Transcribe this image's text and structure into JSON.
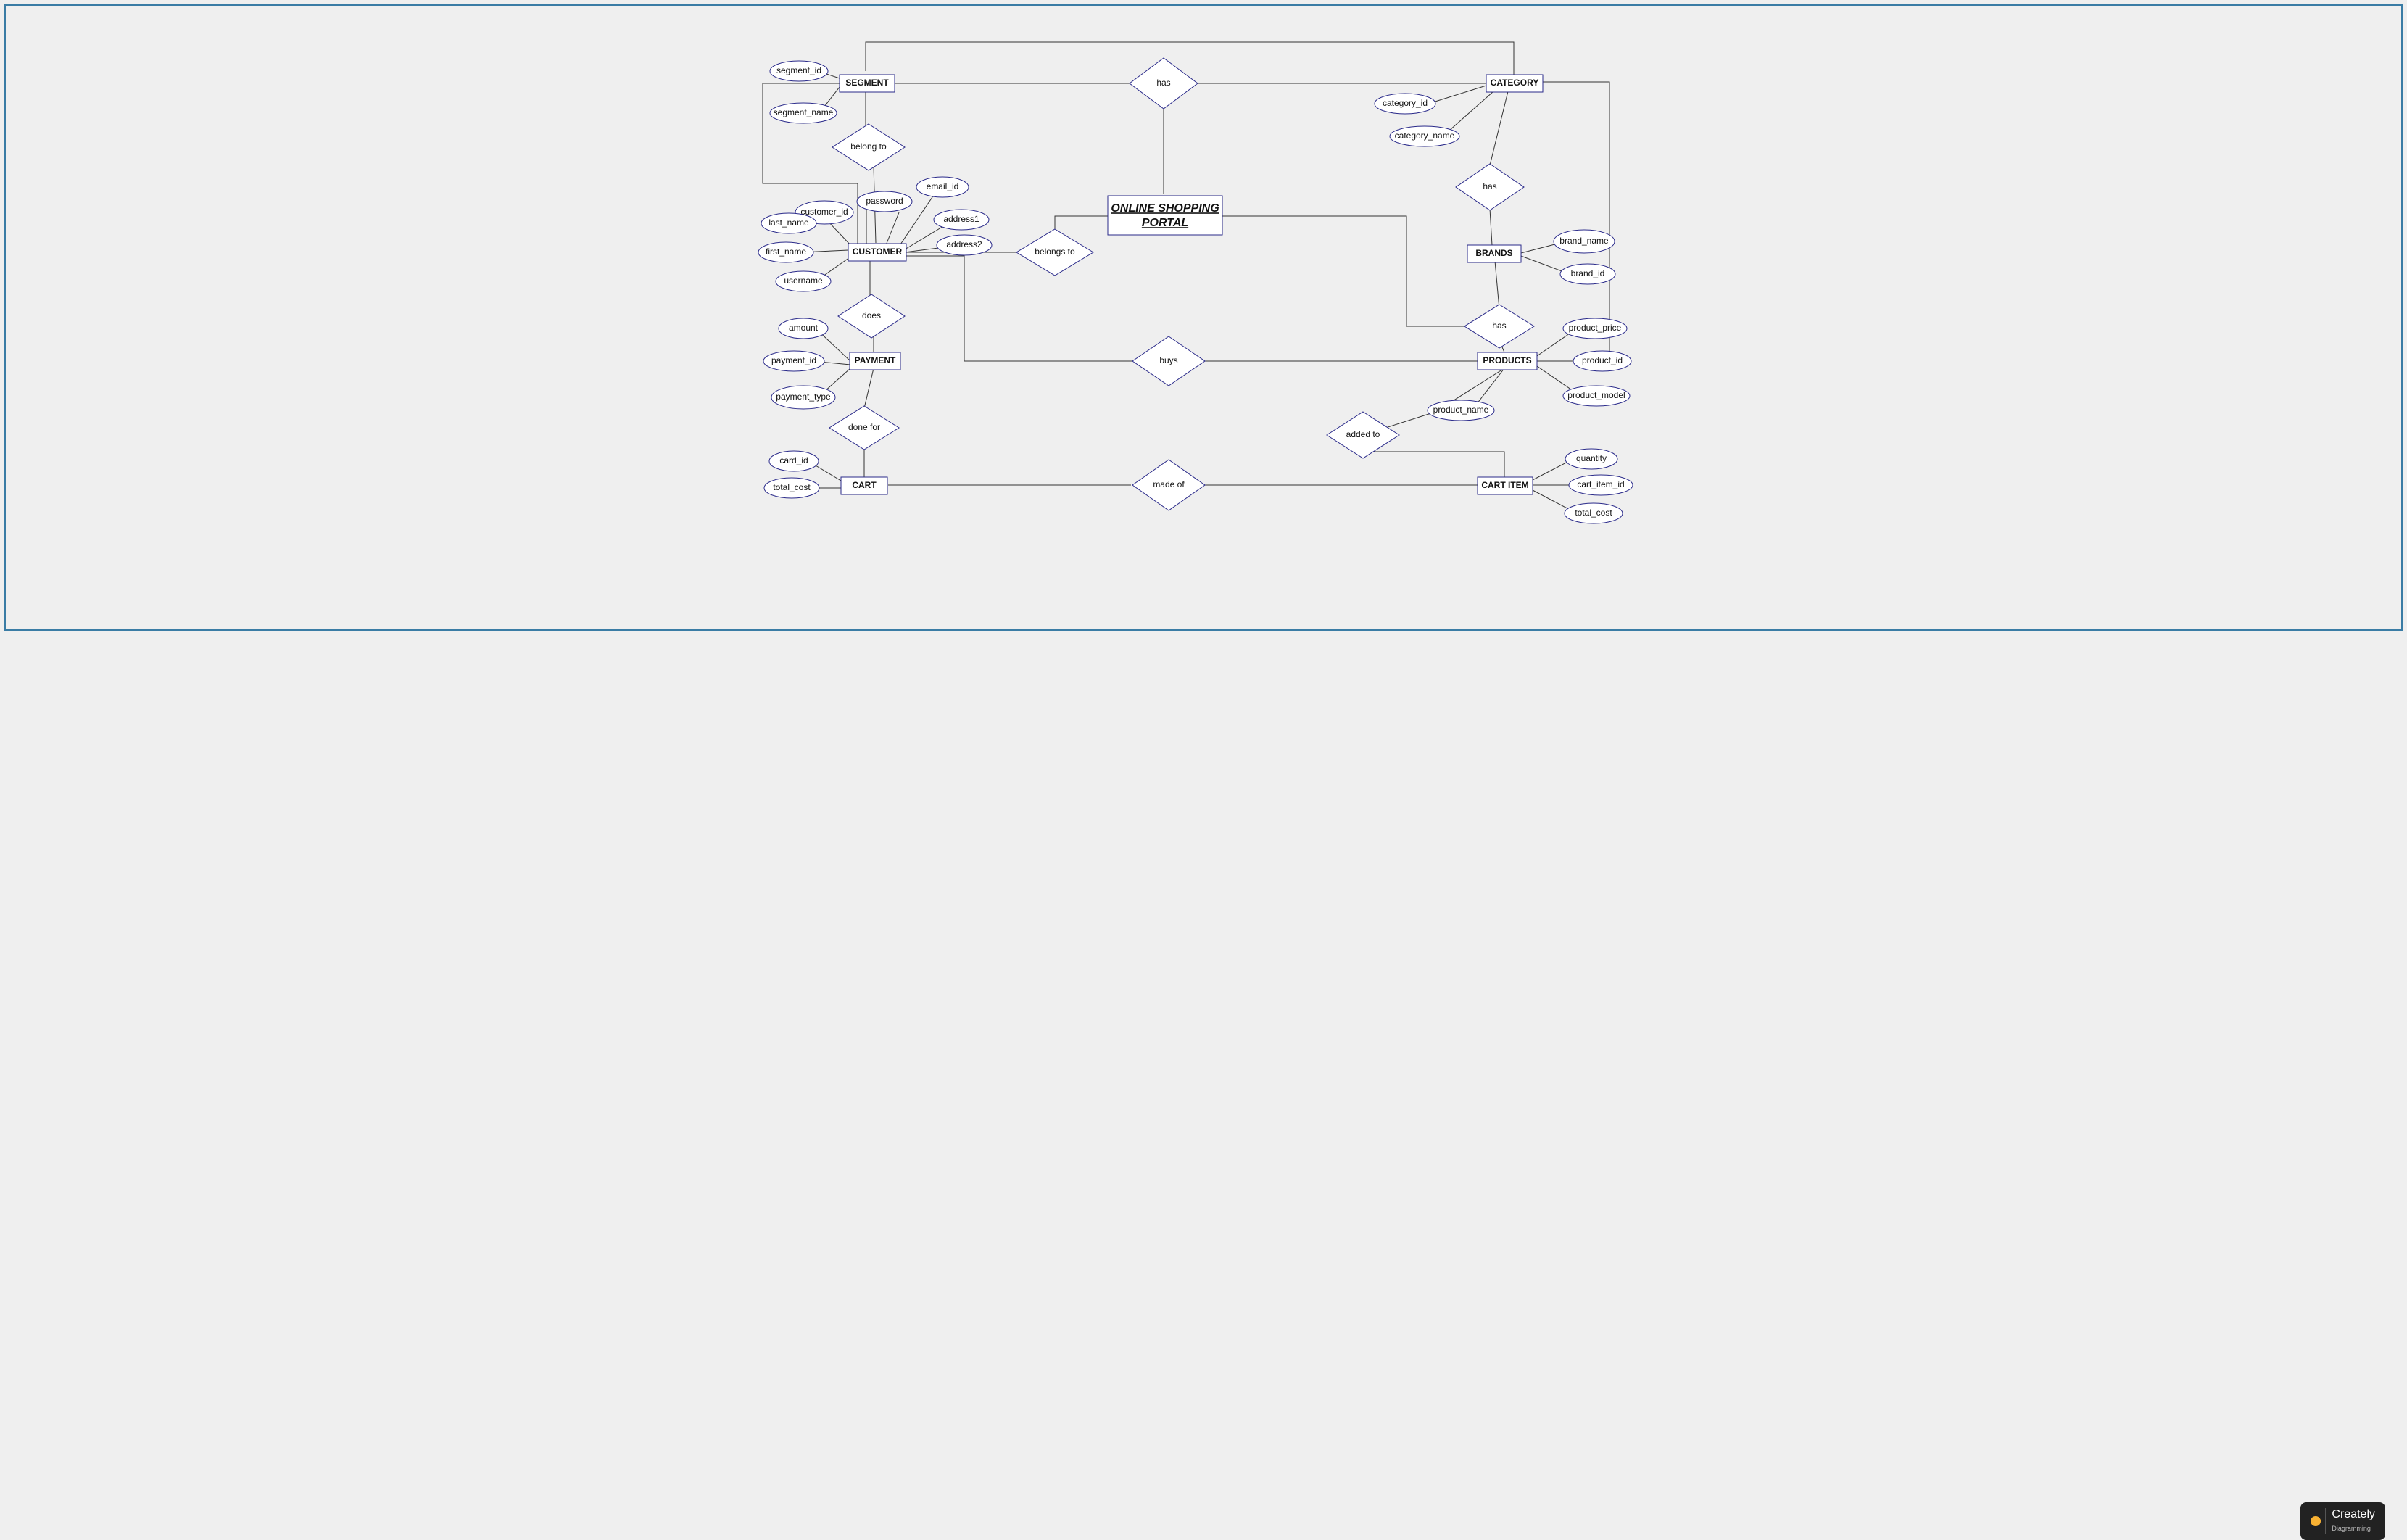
{
  "title": {
    "line1": "ONLINE SHOPPING",
    "line2": "PORTAL"
  },
  "entities": {
    "segment": "SEGMENT",
    "category": "CATEGORY",
    "brands": "BRANDS",
    "customer": "CUSTOMER",
    "payment": "PAYMENT",
    "cart": "CART",
    "products": "PRODUCTS",
    "cartitem": "CART ITEM"
  },
  "relations": {
    "has_top": "has",
    "has_cb": "has",
    "has_bp": "has",
    "belong_to": "belong to",
    "belongs_to": "belongs to",
    "does": "does",
    "buys": "buys",
    "done_for": "done for",
    "made_of": "made of",
    "added_to": "added to"
  },
  "attrs": {
    "segment_id": "segment_id",
    "segment_name": "segment_name",
    "category_id": "category_id",
    "category_name": "category_name",
    "brand_name": "brand_name",
    "brand_id": "brand_id",
    "customer_id": "customer_id",
    "password": "password",
    "email_id": "email_id",
    "last_name": "last_name",
    "first_name": "first_name",
    "username": "username",
    "address1": "address1",
    "address2": "address2",
    "amount": "amount",
    "payment_id": "payment_id",
    "payment_type": "payment_type",
    "card_id": "card_id",
    "total_cost": "total_cost",
    "product_price": "product_price",
    "product_id": "product_id",
    "product_model": "product_model",
    "product_name": "product_name",
    "quantity": "quantity",
    "cart_item_id": "cart_item_id",
    "total_cost2": "total_cost"
  },
  "branding": {
    "name": "Creately",
    "tagline": "Diagramming"
  }
}
